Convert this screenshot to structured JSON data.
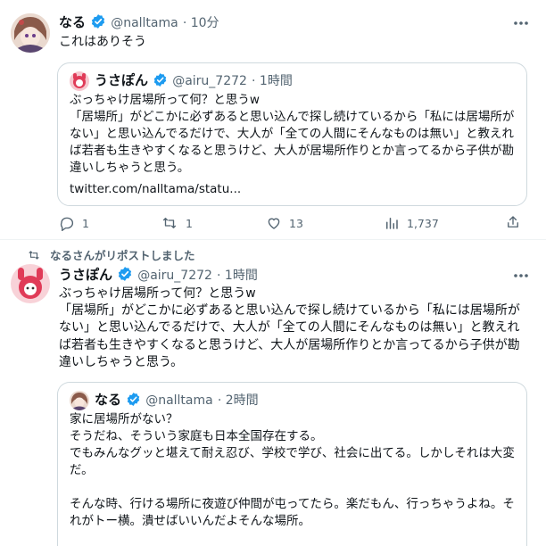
{
  "tweet1": {
    "name": "なる",
    "handle": "@nalltama",
    "time": "· 10分",
    "text": "これはありそう",
    "quote": {
      "name": "うさぽん",
      "handle": "@airu_7272",
      "time": "· 1時間",
      "text": "ぶっちゃけ居場所って何？と思うw\n「居場所」がどこかに必ずあると思い込んで探し続けているから「私には居場所がない」と思い込んでるだけで、大人が「全ての人間にそんなものは無い」と教えれば若者も生きやすくなると思うけど、大人が居場所作りとか言ってるから子供が勘違いしちゃうと思う。",
      "link": "twitter.com/nalltama/statu..."
    },
    "actions": {
      "reply": "1",
      "retweet": "1",
      "like": "13",
      "views": "1,737"
    }
  },
  "tweet2": {
    "repost_label": "なるさんがリポストしました",
    "name": "うさぽん",
    "handle": "@airu_7272",
    "time": "· 1時間",
    "text": "ぶっちゃけ居場所って何？と思うw\n「居場所」がどこかに必ずあると思い込んで探し続けているから「私には居場所がない」と思い込んでるだけで、大人が「全ての人間にそんなものは無い」と教えれば若者も生きやすくなると思うけど、大人が居場所作りとか言ってるから子供が勘違いしちゃうと思う。",
    "quote": {
      "name": "なる",
      "handle": "@nalltama",
      "time": "· 2時間",
      "text": "家に居場所がない？\nそうだね、そういう家庭も日本全国存在する。\nでもみんなグッと堪えて耐え忍び、学校で学び、社会に出てる。しかしそれは大変だ。\n\nそんな時、行ける場所に夜遊び仲間が屯ってたら。楽だもん、行っちゃうよね。それがトー横。潰せばいいんだよそんな場所。"
    }
  },
  "colors": {
    "verified": "#1d9bf0",
    "muted": "#536471",
    "border": "#cfd9de"
  }
}
